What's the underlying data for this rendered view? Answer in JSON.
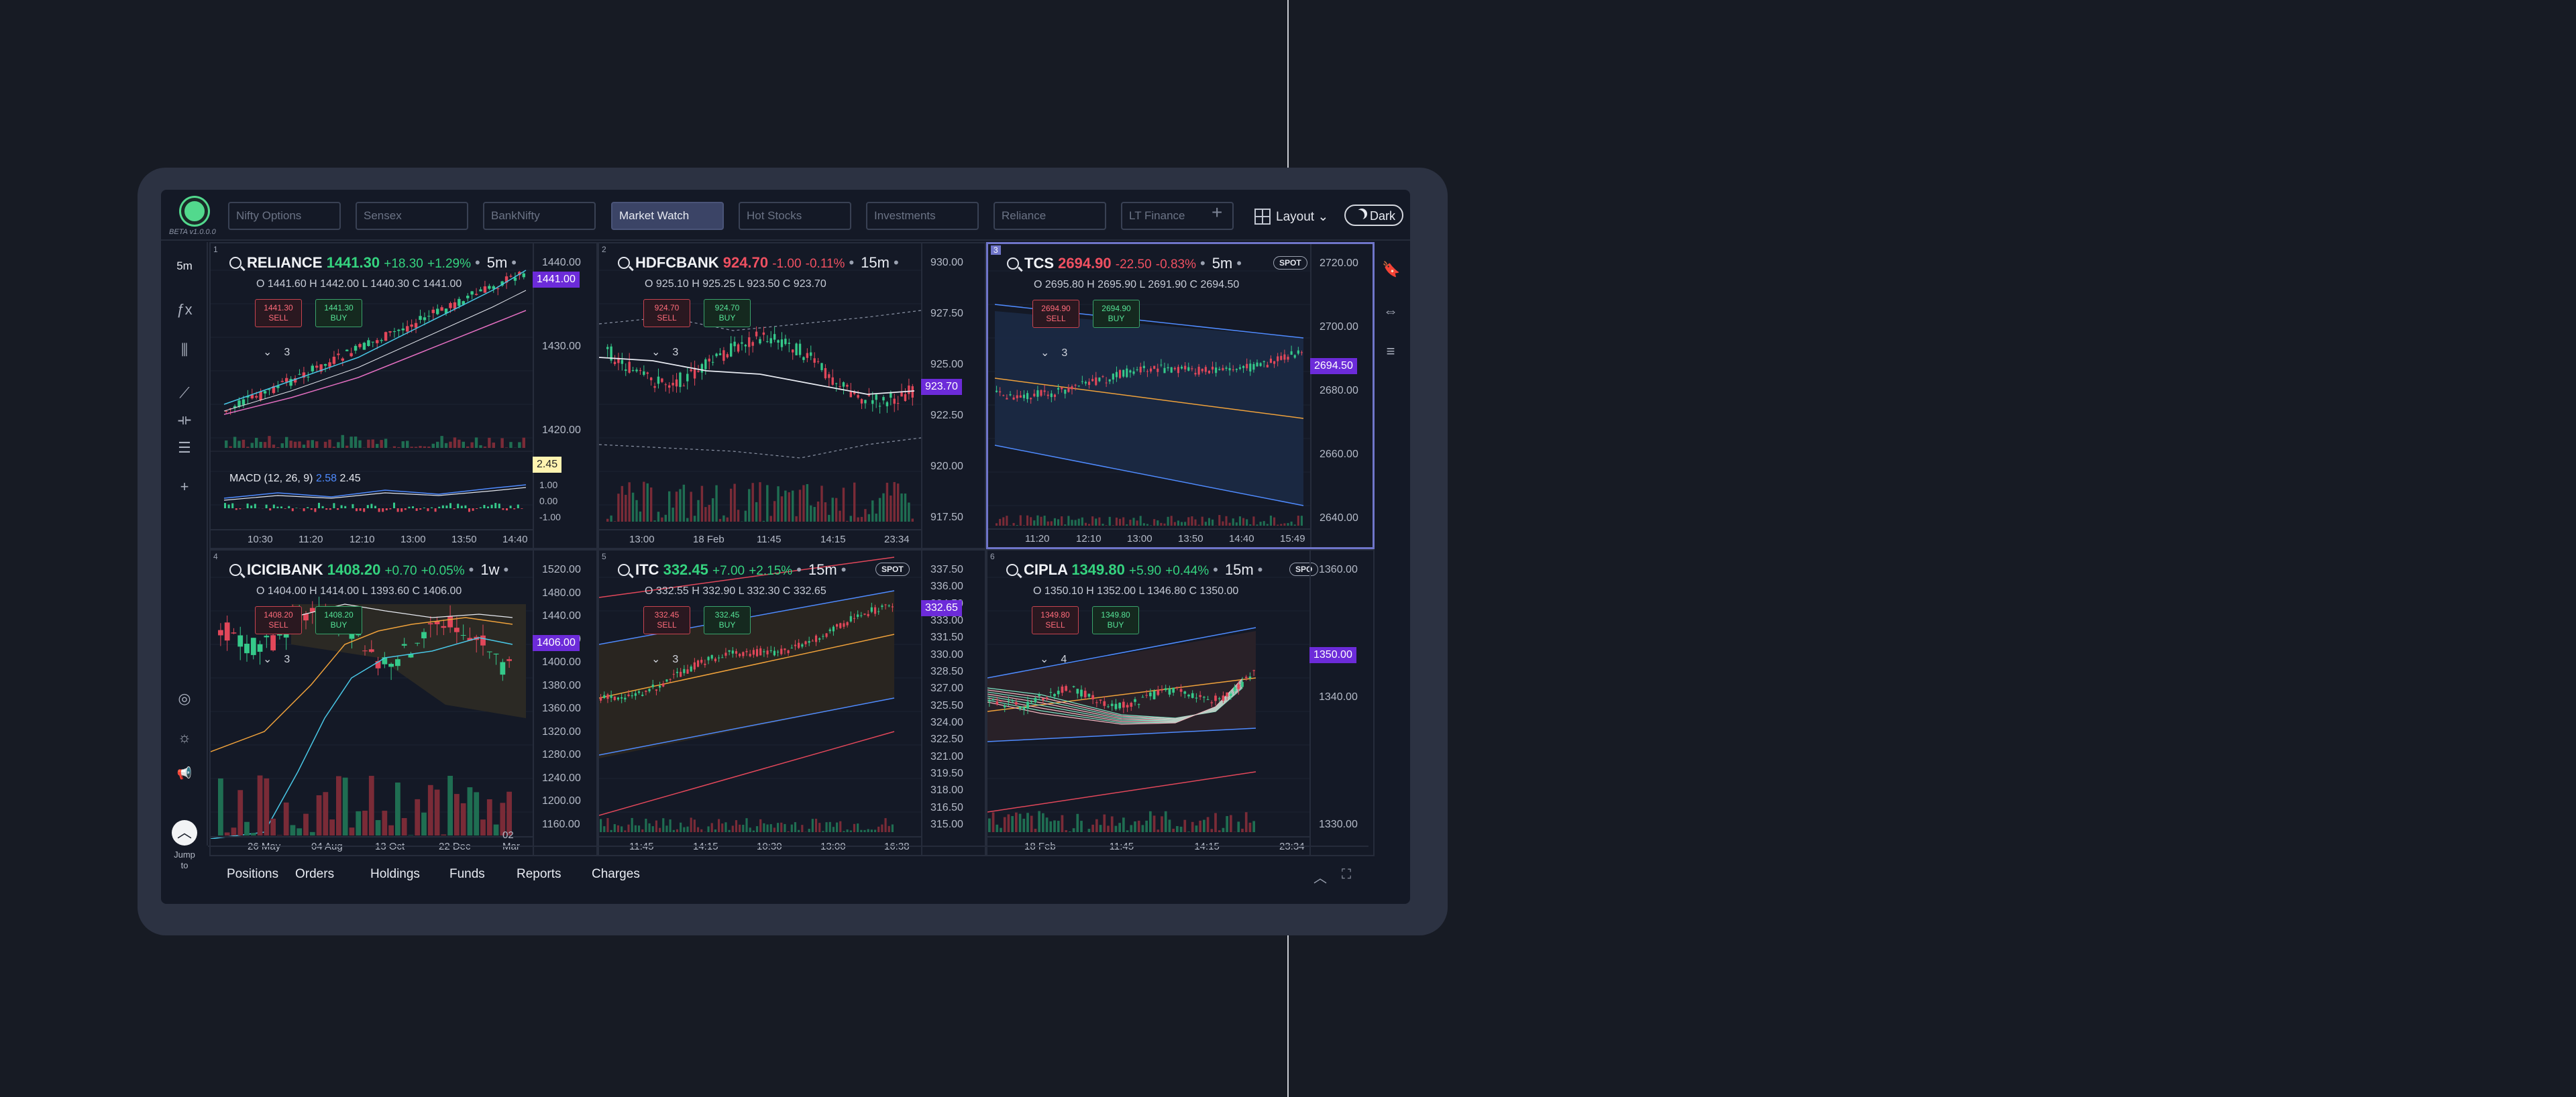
{
  "app": {
    "version": "BETA v1.0.0.0"
  },
  "watchlists": [
    "Nifty Options",
    "Sensex",
    "BankNifty",
    "Market Watch",
    "Hot Stocks",
    "Investments",
    "Reliance",
    "LT Finance"
  ],
  "activeWatchlist": 3,
  "topbar": {
    "add": "+",
    "layout": "Layout",
    "layout_caret": "⌄",
    "theme": "Dark"
  },
  "lefttools": {
    "timeframe": "5m",
    "indicator": "ƒx",
    "candle": "⫼",
    "trendline": "⟋",
    "hline": "⟛",
    "fib": "☰",
    "crosshair": "+",
    "alerts": "◎",
    "ideas": "☼",
    "news": "📢",
    "jump": "︿",
    "jump_label": "Jump to"
  },
  "righttools": {
    "bookmark": "🔖",
    "link": "⇔",
    "list": "≡"
  },
  "panels": [
    {
      "num": "1",
      "sym": "RELIANCE",
      "ltp": "1441.30",
      "chg": "+18.30",
      "pct": "+1.29%",
      "dir": "up",
      "tf": "5m",
      "ohlc": "O 1441.60   H 1442.00   L 1440.30   C 1441.00",
      "sell": "1441.30",
      "buy": "1441.30",
      "sell_label": "SELL",
      "buy_label": "BUY",
      "count": "3",
      "prices": [
        "1440.00",
        "1430.00",
        "1420.00"
      ],
      "tag": "1441.00",
      "times": [
        "10:30",
        "11:20",
        "12:10",
        "13:00",
        "13:50",
        "14:40"
      ],
      "macd": "MACD (12, 26, 9)",
      "macd_a": "2.58",
      "macd_b": "2.45",
      "macd_tag": "2.45",
      "macd_levels": [
        "1.00",
        "0.00",
        "-1.00"
      ]
    },
    {
      "num": "2",
      "sym": "HDFCBANK",
      "ltp": "924.70",
      "chg": "-1.00",
      "pct": "-0.11%",
      "dir": "dn",
      "tf": "15m",
      "ohlc": "O 925.10   H 925.25   L 923.50   C 923.70",
      "sell": "924.70",
      "buy": "924.70",
      "sell_label": "SELL",
      "buy_label": "BUY",
      "count": "3",
      "prices": [
        "930.00",
        "927.50",
        "925.00",
        "922.50",
        "920.00",
        "917.50"
      ],
      "tag": "923.70",
      "times": [
        "13:00",
        "18 Feb",
        "11:45",
        "14:15",
        "23:34"
      ]
    },
    {
      "num": "3",
      "sym": "TCS",
      "ltp": "2694.90",
      "chg": "-22.50",
      "pct": "-0.83%",
      "dir": "dn",
      "tf": "5m",
      "spot": "SPOT",
      "ohlc": "O 2695.80   H 2695.90   L 2691.90   C 2694.50",
      "sell": "2694.90",
      "buy": "2694.90",
      "sell_label": "SELL",
      "buy_label": "BUY",
      "count": "3",
      "prices": [
        "2720.00",
        "2700.00",
        "2680.00",
        "2660.00",
        "2640.00"
      ],
      "tag": "2694.50",
      "times": [
        "11:20",
        "12:10",
        "13:00",
        "13:50",
        "14:40",
        "15:49"
      ]
    },
    {
      "num": "4",
      "sym": "ICICIBANK",
      "ltp": "1408.20",
      "chg": "+0.70",
      "pct": "+0.05%",
      "dir": "up",
      "tf": "1w",
      "ohlc": "O 1404.00   H 1414.00   L 1393.60   C 1406.00",
      "sell": "1408.20",
      "buy": "1408.20",
      "sell_label": "SELL",
      "buy_label": "BUY",
      "count": "3",
      "prices": [
        "1520.00",
        "1480.00",
        "1440.00",
        "1420.00",
        "1400.00",
        "1380.00",
        "1360.00",
        "1320.00",
        "1280.00",
        "1240.00",
        "1200.00",
        "1160.00"
      ],
      "tag": "1406.00",
      "times": [
        "26 May",
        "04 Aug",
        "13 Oct",
        "22 Dec",
        "02 Mar"
      ]
    },
    {
      "num": "5",
      "sym": "ITC",
      "ltp": "332.45",
      "chg": "+7.00",
      "pct": "+2.15%",
      "dir": "up",
      "tf": "15m",
      "spot": "SPOT",
      "ohlc": "O 332.55   H 332.90   L 332.30   C 332.65",
      "sell": "332.45",
      "buy": "332.45",
      "sell_label": "SELL",
      "buy_label": "BUY",
      "count": "3",
      "prices": [
        "337.50",
        "336.00",
        "334.50",
        "333.00",
        "331.50",
        "330.00",
        "328.50",
        "327.00",
        "325.50",
        "324.00",
        "322.50",
        "321.00",
        "319.50",
        "318.00",
        "316.50",
        "315.00"
      ],
      "tag": "332.65",
      "times": [
        "11:45",
        "14:15",
        "10:30",
        "13:00",
        "16:38"
      ]
    },
    {
      "num": "6",
      "sym": "CIPLA",
      "ltp": "1349.80",
      "chg": "+5.90",
      "pct": "+0.44%",
      "dir": "up",
      "tf": "15m",
      "spot": "SPO",
      "ohlc": "O 1350.10   H 1352.00   L 1346.80   C 1350.00",
      "sell": "1349.80",
      "buy": "1349.80",
      "sell_label": "SELL",
      "buy_label": "BUY",
      "count": "4",
      "prices": [
        "1360.00",
        "1340.00",
        "1330.00"
      ],
      "tag": "1350.00",
      "times": [
        "18 Feb",
        "11:45",
        "14:15",
        "23:34"
      ]
    }
  ],
  "bottom": {
    "tabs": [
      "Positions",
      "Orders",
      "Holdings",
      "Funds",
      "Reports",
      "Charges"
    ],
    "collapse": "︿",
    "expand": "⛶"
  },
  "colors": {
    "up": "#35d37f",
    "down": "#ef5061",
    "accent": "#6c2bd9"
  }
}
